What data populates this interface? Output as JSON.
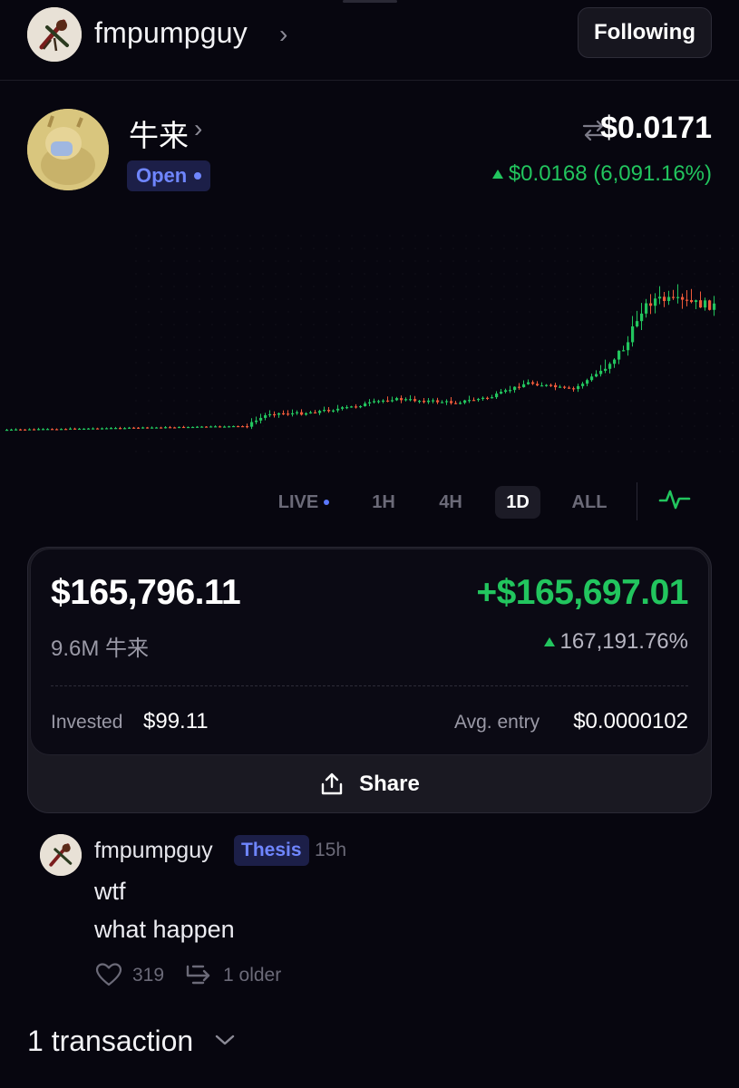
{
  "header": {
    "username": "fmpumpguy",
    "follow_label": "Following"
  },
  "token": {
    "name": "牛来",
    "status": "Open",
    "price": "$0.0171",
    "change": "$0.0168 (6,091.16%)"
  },
  "timeframes": {
    "live": "LIVE",
    "h1": "1H",
    "h4": "4H",
    "d1": "1D",
    "all": "ALL",
    "selected": "1D"
  },
  "position": {
    "value": "$165,796.11",
    "pnl": "+$165,697.01",
    "holdings": "9.6M 牛来",
    "pnl_pct": "167,191.76%",
    "invested_label": "Invested",
    "invested_value": "$99.11",
    "avg_entry_label": "Avg. entry",
    "avg_entry_value": "$0.0000102",
    "share_label": "Share"
  },
  "post": {
    "username": "fmpumpguy",
    "tag": "Thesis",
    "time": "15h",
    "line1": "wtf",
    "line2": "what happen",
    "likes": "319",
    "replies": "1 older"
  },
  "transactions": {
    "label": "1 transaction"
  },
  "colors": {
    "background": "#07060f",
    "up": "#22c55e",
    "down": "#ef5a3a",
    "accent": "#6f86ff"
  }
}
